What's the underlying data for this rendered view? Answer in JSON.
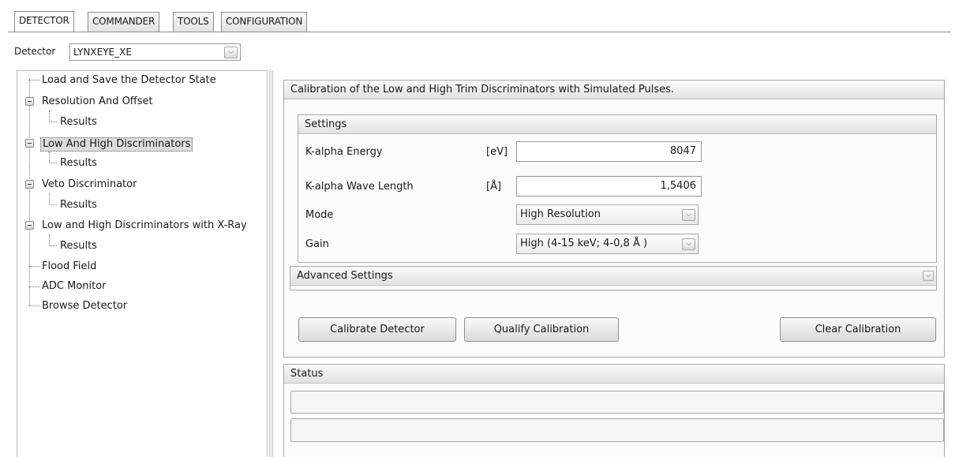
{
  "tabs": [
    {
      "label": "DETECTOR",
      "active": true
    },
    {
      "label": "COMMANDER",
      "active": false
    },
    {
      "label": "TOOLS",
      "active": false
    },
    {
      "label": "CONFIGURATION",
      "active": false
    }
  ],
  "detector": {
    "label": "Detector",
    "selected": "LYNXEYE_XE"
  },
  "tree": {
    "items": [
      {
        "label": "Load and Save the Detector State"
      },
      {
        "label": "Resolution And Offset"
      },
      {
        "label": "Results"
      },
      {
        "label": "Low And High Discriminators",
        "selected": true
      },
      {
        "label": "Results"
      },
      {
        "label": "Veto Discriminator"
      },
      {
        "label": "Results"
      },
      {
        "label": "Low and High Discriminators with X-Ray"
      },
      {
        "label": "Results"
      },
      {
        "label": "Flood Field"
      },
      {
        "label": "ADC Monitor"
      },
      {
        "label": "Browse Detector"
      }
    ]
  },
  "main": {
    "title": "Calibration of the Low and High Trim Discriminators with Simulated Pulses.",
    "settings": {
      "header": "Settings",
      "k_alpha_energy": {
        "label": "K-alpha Energy",
        "unit": "[eV]",
        "value": "8047"
      },
      "k_alpha_wavelength": {
        "label": "K-alpha Wave Length",
        "unit": "[Å]",
        "value": "1,5406"
      },
      "mode": {
        "label": "Mode",
        "value": "High Resolution"
      },
      "gain": {
        "label": "Gain",
        "value": "High (4-15 keV; 4-0,8 Å )"
      }
    },
    "advanced": {
      "header": "Advanced Settings"
    },
    "buttons": {
      "calibrate": "Calibrate Detector",
      "qualify": "Qualify Calibration",
      "clear": "Clear Calibration"
    }
  },
  "status": {
    "header": "Status"
  },
  "icons": {
    "dropdown": "chevron-down-icon",
    "collapse": "minus-icon"
  },
  "colors": {
    "panel_border": "#a8a8a8",
    "selection": "#dcdcdc"
  }
}
